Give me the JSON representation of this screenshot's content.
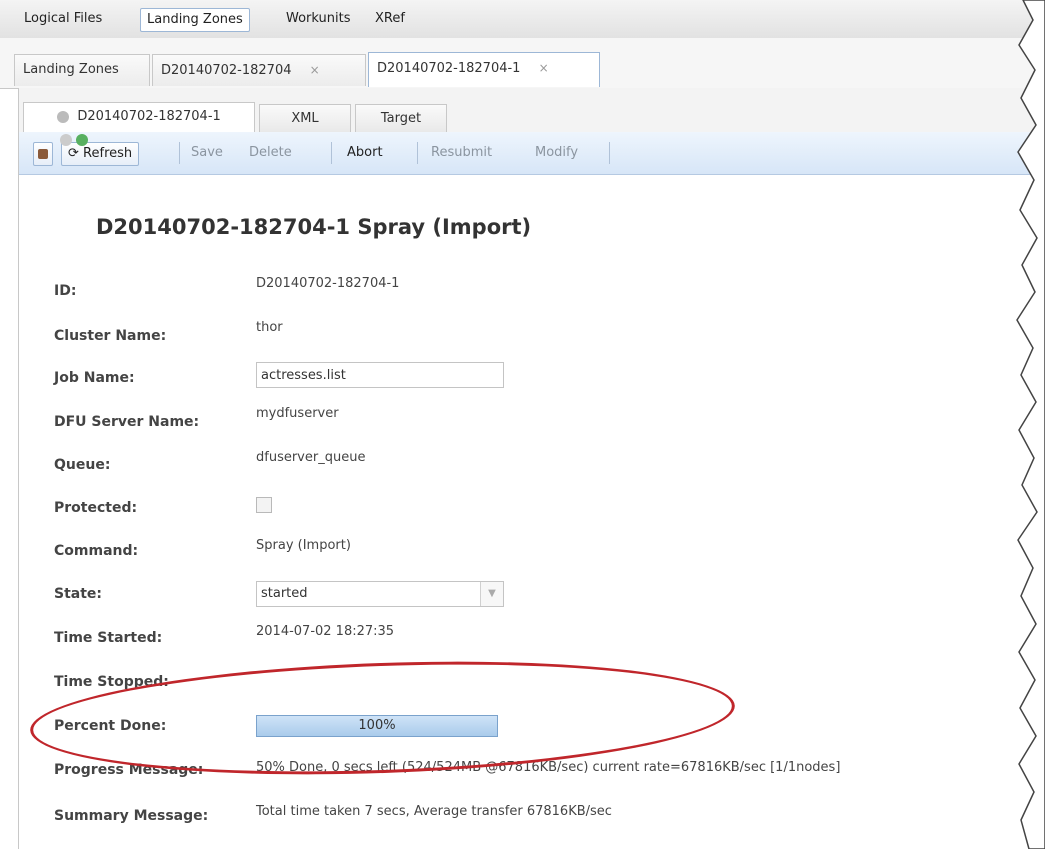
{
  "topnav": {
    "items": [
      "Logical Files",
      "Landing Zones",
      "Workunits",
      "XRef"
    ],
    "active": "Landing Zones"
  },
  "outer_tabs": [
    {
      "label": "Landing Zones"
    },
    {
      "label": "D20140702-182704",
      "close": "×"
    },
    {
      "label": "D20140702-182704-1",
      "close": "×"
    }
  ],
  "inner_tabs": [
    "D20140702-182704-1",
    "XML",
    "Target"
  ],
  "toolbar": {
    "refresh": "Refresh",
    "save": "Save",
    "delete": "Delete",
    "abort": "Abort",
    "resubmit": "Resubmit",
    "modify": "Modify"
  },
  "title": "D20140702-182704-1 Spray (Import)",
  "fields": {
    "id_label": "ID:",
    "id_value": "D20140702-182704-1",
    "cluster_label": "Cluster Name:",
    "cluster_value": "thor",
    "job_label": "Job Name:",
    "job_value": "actresses.list",
    "dfu_label": "DFU Server Name:",
    "dfu_value": "mydfuserver",
    "queue_label": "Queue:",
    "queue_value": "dfuserver_queue",
    "protected_label": "Protected:",
    "command_label": "Command:",
    "command_value": "Spray (Import)",
    "state_label": "State:",
    "state_value": "started",
    "started_label": "Time Started:",
    "started_value": "2014-07-02 18:27:35",
    "stopped_label": "Time Stopped:",
    "percent_label": "Percent Done:",
    "percent_value": "100%",
    "percent_fraction": 1.0,
    "progress_label": "Progress Message:",
    "progress_value": "50% Done, 0 secs left (524/524MB @67816KB/sec) current rate=67816KB/sec [1/1nodes]",
    "summary_label": "Summary Message:",
    "summary_value": "Total time taken 7 secs, Average transfer 67816KB/sec"
  },
  "colors": {
    "highlight_ellipse": "#c0262b",
    "toolbar_bg": "#d7e6f7",
    "progress_fill": "#a9cbeb"
  }
}
